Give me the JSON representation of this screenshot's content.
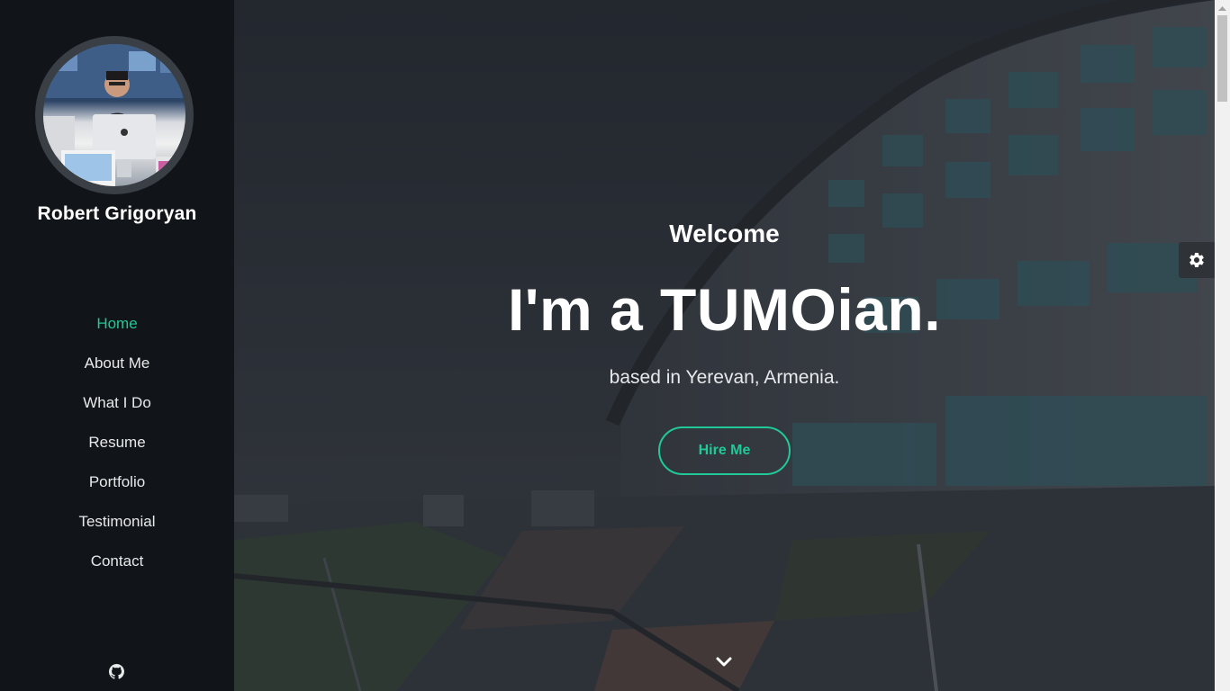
{
  "sidebar": {
    "profile_name": "Robert Grigoryan",
    "nav_items": [
      {
        "label": "Home",
        "active": true
      },
      {
        "label": "About Me",
        "active": false
      },
      {
        "label": "What I Do",
        "active": false
      },
      {
        "label": "Resume",
        "active": false
      },
      {
        "label": "Portfolio",
        "active": false
      },
      {
        "label": "Testimonial",
        "active": false
      },
      {
        "label": "Contact",
        "active": false
      }
    ],
    "social_icon": "github-icon"
  },
  "hero": {
    "welcome": "Welcome",
    "headline": "I'm a TUMOian.",
    "subline": "based in Yerevan, Armenia.",
    "cta_label": "Hire Me",
    "scroll_icon": "chevron-down-icon"
  },
  "settings_icon": "gear-icon",
  "colors": {
    "accent": "#20c997",
    "sidebar_bg": "#111418",
    "text": "#ffffff"
  }
}
